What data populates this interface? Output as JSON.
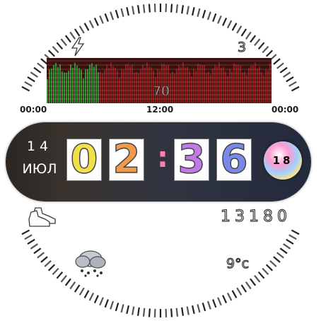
{
  "status": {
    "battery_level": "3"
  },
  "heart_rate": {
    "value": "70",
    "time_labels": [
      "00:00",
      "12:00",
      "00:00"
    ],
    "colors": {
      "recent": "#2e8b2e",
      "history": "#8b1a1a"
    }
  },
  "date": {
    "day": "14",
    "month": "ИЮЛ"
  },
  "time": {
    "hours": [
      "0",
      "2"
    ],
    "minutes": [
      "3",
      "6"
    ],
    "seconds": "18",
    "digit_colors": [
      "#f2e04b",
      "#f29a4b",
      "#c07be8",
      "#7a89e8"
    ]
  },
  "steps": {
    "value": "13180"
  },
  "weather": {
    "temperature": "9°c",
    "icon": "cloud-snow-icon"
  }
}
